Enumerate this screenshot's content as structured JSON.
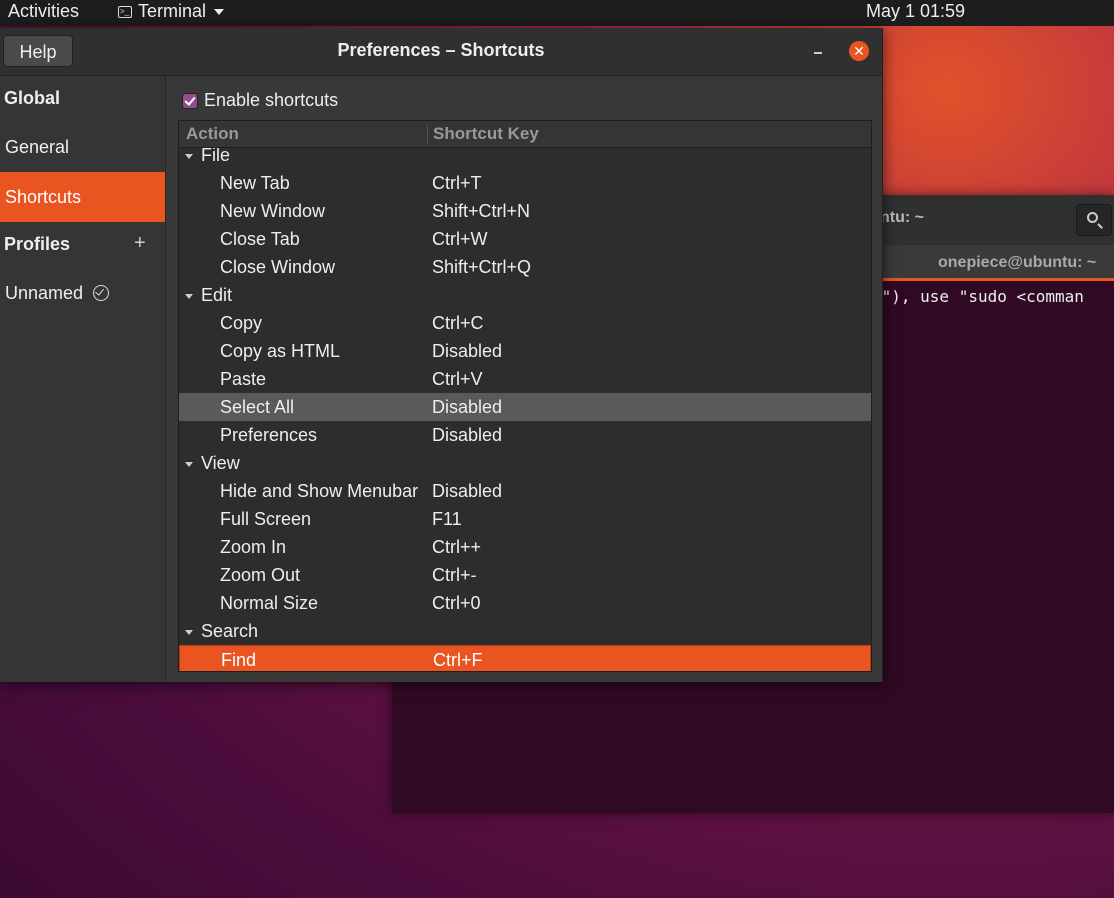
{
  "topbar": {
    "activities": "Activities",
    "app_menu": "Terminal",
    "clock": "May 1  01:59"
  },
  "background_terminal": {
    "title": "ntu: ~",
    "tab_label": "onepiece@ubuntu: ~",
    "text": "t\"), use \"sudo <comman"
  },
  "dialog": {
    "title": "Preferences – Shortcuts",
    "help_label": "Help",
    "close_glyph": "✕"
  },
  "sidebar": {
    "global_heading": "Global",
    "general": "General",
    "shortcuts": "Shortcuts",
    "profiles_heading": "Profiles",
    "add_glyph": "+",
    "profile_unnamed": "Unnamed"
  },
  "content": {
    "enable_label": "Enable shortcuts",
    "enabled": true,
    "col_action": "Action",
    "col_key": "Shortcut Key",
    "rows": [
      {
        "group": true,
        "action": "File",
        "key": ""
      },
      {
        "group": false,
        "action": "New Tab",
        "key": "Ctrl+T"
      },
      {
        "group": false,
        "action": "New Window",
        "key": "Shift+Ctrl+N"
      },
      {
        "group": false,
        "action": "Close Tab",
        "key": "Ctrl+W"
      },
      {
        "group": false,
        "action": "Close Window",
        "key": "Shift+Ctrl+Q"
      },
      {
        "group": true,
        "action": "Edit",
        "key": ""
      },
      {
        "group": false,
        "action": "Copy",
        "key": "Ctrl+C"
      },
      {
        "group": false,
        "action": "Copy as HTML",
        "key": "Disabled"
      },
      {
        "group": false,
        "action": "Paste",
        "key": "Ctrl+V"
      },
      {
        "group": false,
        "action": "Select All",
        "key": "Disabled",
        "state": "hover"
      },
      {
        "group": false,
        "action": "Preferences",
        "key": "Disabled"
      },
      {
        "group": true,
        "action": "View",
        "key": ""
      },
      {
        "group": false,
        "action": "Hide and Show Menubar",
        "key": "Disabled"
      },
      {
        "group": false,
        "action": "Full Screen",
        "key": "F11"
      },
      {
        "group": false,
        "action": "Zoom In",
        "key": "Ctrl++"
      },
      {
        "group": false,
        "action": "Zoom Out",
        "key": "Ctrl+-"
      },
      {
        "group": false,
        "action": "Normal Size",
        "key": "Ctrl+0"
      },
      {
        "group": true,
        "action": "Search",
        "key": ""
      },
      {
        "group": false,
        "action": "Find",
        "key": "Ctrl+F",
        "state": "selected"
      }
    ]
  },
  "colors": {
    "accent": "#e95420",
    "hover_row": "#5a5a5a",
    "checkbox": "#924d8b"
  }
}
